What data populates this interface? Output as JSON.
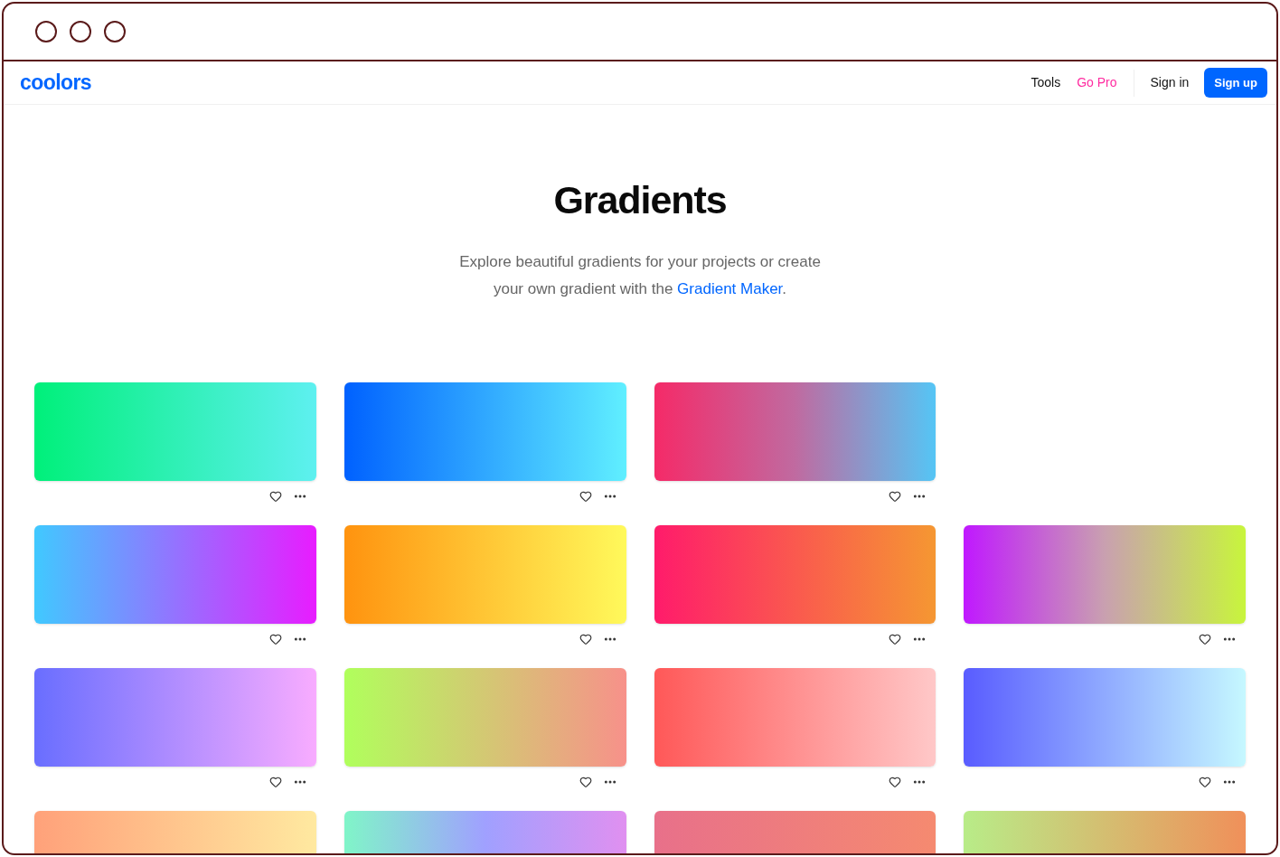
{
  "brand": "coolors",
  "nav": {
    "links": [
      {
        "label": "Tools",
        "kind": "plain"
      },
      {
        "label": "Go Pro",
        "kind": "pro"
      }
    ],
    "sign_in": "Sign in",
    "sign_up": "Sign up"
  },
  "hero": {
    "title": "Gradients",
    "text_before": "Explore beautiful gradients for your projects or create your own gradient with the",
    "link": "Gradient Maker",
    "text_after": "."
  },
  "rows": [
    [
      {
        "stops": [
          {
            "color": "#00f07a"
          },
          {
            "color": "#5ef0f0"
          }
        ]
      },
      {
        "stops": [
          {
            "color": "#0061ff"
          },
          {
            "color": "#60efff"
          }
        ]
      },
      {
        "stops": [
          {
            "color": "#f52a68"
          },
          {
            "color": "#c06aa0"
          },
          {
            "color": "#55c5f5"
          }
        ]
      }
    ],
    [
      {
        "stops": [
          {
            "color": "#40c9ff"
          },
          {
            "color": "#e81cff"
          }
        ]
      },
      {
        "stops": [
          {
            "color": "#ff930f"
          },
          {
            "color": "#fff95b"
          }
        ]
      },
      {
        "stops": [
          {
            "color": "#ff1b6b"
          },
          {
            "color": "#f59732"
          }
        ]
      },
      {
        "stops": [
          {
            "color": "#c018ff"
          },
          {
            "color": "#c9a0b0"
          },
          {
            "color": "#c8f53c"
          }
        ]
      }
    ],
    [
      {
        "stops": [
          {
            "color": "#696eff"
          },
          {
            "color": "#f8acff"
          }
        ]
      },
      {
        "stops": [
          {
            "color": "#b0ff5c"
          },
          {
            "color": "#f7918a"
          }
        ]
      },
      {
        "stops": [
          {
            "color": "#ff5858"
          },
          {
            "color": "#ffc8c8"
          }
        ]
      },
      {
        "stops": [
          {
            "color": "#595cff"
          },
          {
            "color": "#c6f8ff"
          }
        ]
      }
    ],
    [
      {
        "stops": [
          {
            "color": "#ffa17a"
          },
          {
            "color": "#ffe9a0"
          }
        ]
      },
      {
        "stops": [
          {
            "color": "#80f5c8"
          },
          {
            "color": "#a0a0ff"
          },
          {
            "color": "#e090f0"
          }
        ]
      },
      {
        "stops": [
          {
            "color": "#e8708a"
          },
          {
            "color": "#f58a70"
          }
        ]
      },
      {
        "stops": [
          {
            "color": "#b8ec88"
          },
          {
            "color": "#f0905a"
          }
        ]
      }
    ]
  ]
}
